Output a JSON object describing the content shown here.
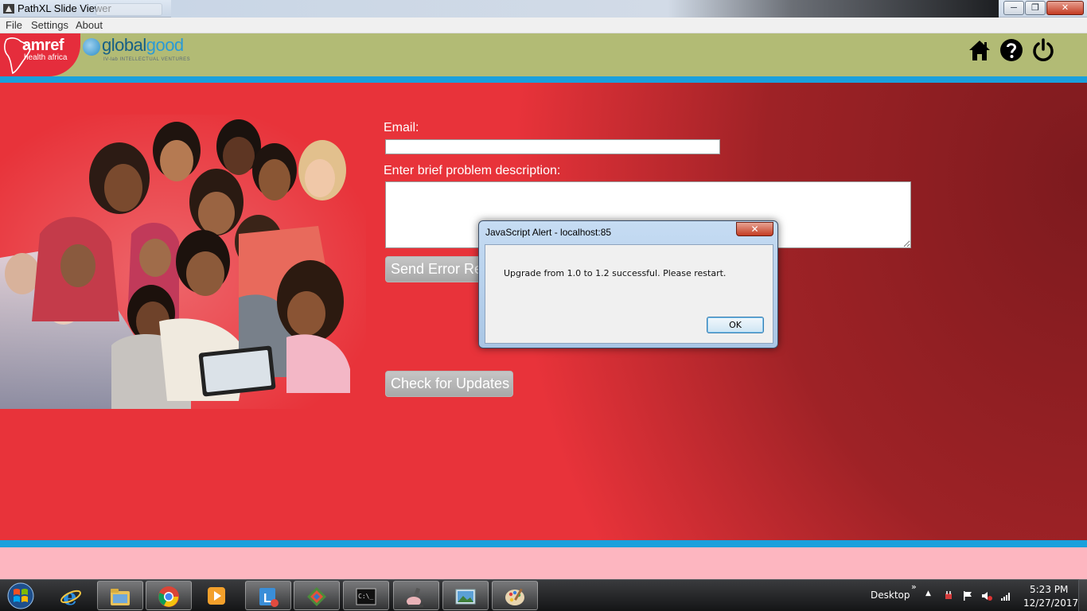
{
  "window": {
    "title": "PathXL Slide Viewer",
    "minimize": "─",
    "maximize": "❐",
    "close": "✕"
  },
  "menu": [
    "File",
    "Settings",
    "About"
  ],
  "logos": {
    "amref_line1": "amref",
    "amref_line2": "health africa",
    "globalgood_a": "global",
    "globalgood_b": "good",
    "globalgood_tag": "IV-lab INTELLECTUAL VENTURES"
  },
  "header_icons": [
    "home-icon",
    "help-icon",
    "power-icon"
  ],
  "form": {
    "email_label": "Email:",
    "email_value": "",
    "description_label": "Enter brief problem description:",
    "description_value": "",
    "send_button": "Send Error Report",
    "check_button": "Check for Updates"
  },
  "dialog": {
    "title": "JavaScript Alert - localhost:85",
    "message": "Upgrade from 1.0 to 1.2 successful. Please restart.",
    "ok": "OK",
    "close": "✕"
  },
  "taskbar": {
    "items": [
      "internet-explorer",
      "file-explorer",
      "chrome",
      "media-player",
      "lync",
      "tool-app",
      "command-prompt",
      "pathxl-viewer",
      "photo-viewer",
      "paint"
    ],
    "active_items": [
      "pathxl-viewer"
    ],
    "desktop_label": "Desktop",
    "chevron": "»",
    "time": "5:23 PM",
    "date": "12/27/2017"
  },
  "colors": {
    "header_bg": "#b2bb75",
    "main_red": "#e8333a",
    "accent_blue": "#1aa0dc",
    "footer_pink": "#fdb6c0"
  }
}
